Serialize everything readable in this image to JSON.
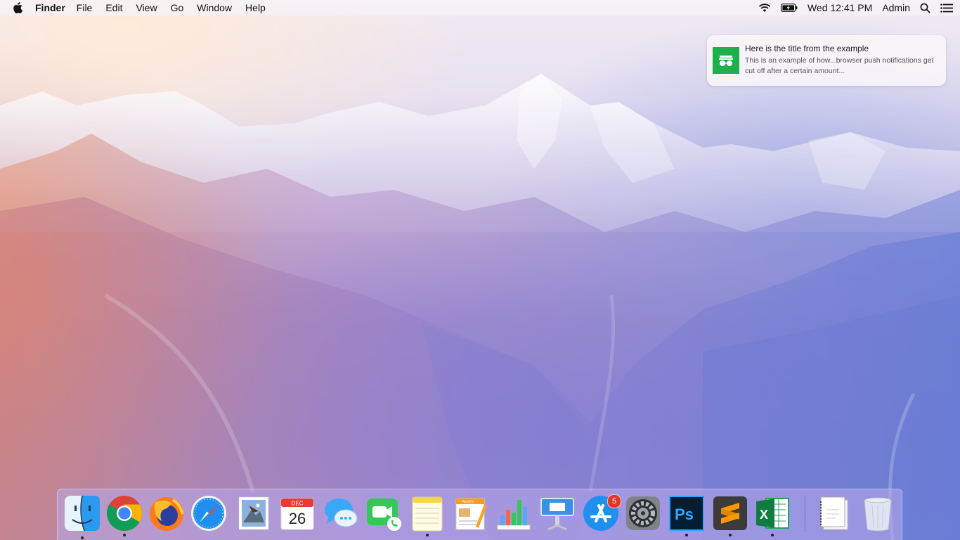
{
  "menubar": {
    "app_name": "Finder",
    "menus": [
      "File",
      "Edit",
      "View",
      "Go",
      "Window",
      "Help"
    ],
    "clock": "Wed 12:41 PM",
    "user": "Admin"
  },
  "notification": {
    "title": "Here is the title from the example",
    "body": "This is an example of how...browser push notifications get cut off after a certain amount..."
  },
  "dock": {
    "calendar": {
      "month": "DEC",
      "day": "26"
    },
    "pages_label": "PAGES",
    "app_store_badge": "5"
  },
  "icons": [
    "apple-icon",
    "wifi-icon",
    "battery-icon",
    "search-icon",
    "notification-list-icon",
    "finder-icon",
    "chrome-icon",
    "firefox-icon",
    "safari-icon",
    "mail-icon",
    "calendar-icon",
    "messages-icon",
    "facetime-icon",
    "notes-icon",
    "pages-icon",
    "numbers-icon",
    "keynote-icon",
    "app-store-icon",
    "system-preferences-icon",
    "photoshop-icon",
    "sublime-text-icon",
    "excel-icon",
    "document-icon",
    "trash-icon"
  ]
}
